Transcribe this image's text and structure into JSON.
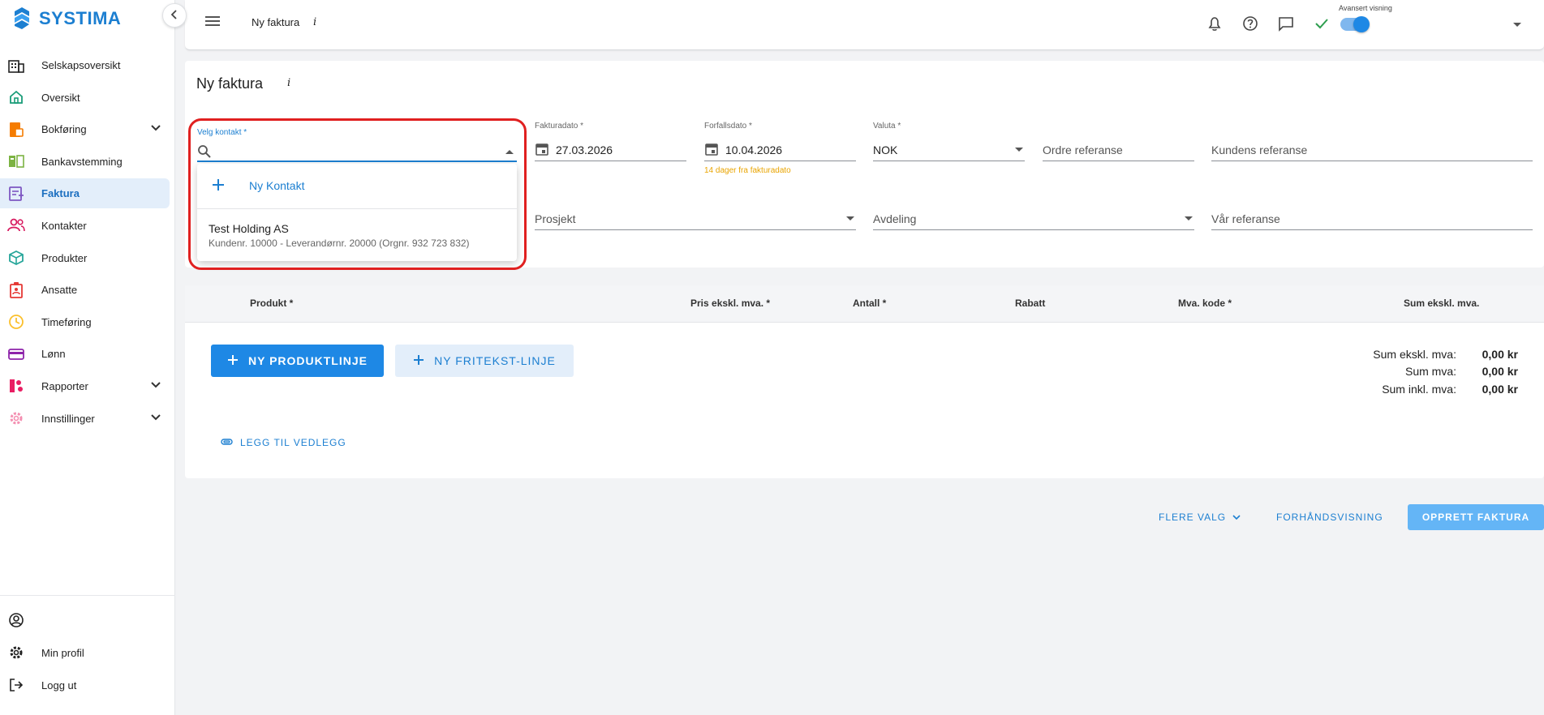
{
  "brand": {
    "name": "SYSTIMA"
  },
  "sidebar": {
    "items": [
      {
        "label": "Selskapsoversikt",
        "icon": "company-overview-icon"
      },
      {
        "label": "Oversikt",
        "icon": "home-icon"
      },
      {
        "label": "Bokføring",
        "icon": "bookkeeping-icon",
        "expandable": true
      },
      {
        "label": "Bankavstemming",
        "icon": "bank-reconciliation-icon"
      },
      {
        "label": "Faktura",
        "icon": "invoice-icon",
        "active": true
      },
      {
        "label": "Kontakter",
        "icon": "contacts-icon"
      },
      {
        "label": "Produkter",
        "icon": "products-icon"
      },
      {
        "label": "Ansatte",
        "icon": "employees-icon"
      },
      {
        "label": "Timeføring",
        "icon": "clock-icon"
      },
      {
        "label": "Lønn",
        "icon": "payroll-icon"
      },
      {
        "label": "Rapporter",
        "icon": "reports-icon",
        "expandable": true
      },
      {
        "label": "Innstillinger",
        "icon": "settings-icon",
        "expandable": true
      }
    ],
    "bottom": [
      {
        "label": "",
        "icon": "account-circle-icon"
      },
      {
        "label": "Min profil",
        "icon": "gear-icon"
      },
      {
        "label": "Logg ut",
        "icon": "logout-icon"
      }
    ]
  },
  "topbar": {
    "title": "Ny faktura",
    "info": "i",
    "advanced_view_label": "Avansert visning",
    "advanced_view_on": true
  },
  "form": {
    "title": "Ny faktura",
    "info": "i",
    "contact": {
      "label": "Velg kontakt *",
      "value": ""
    },
    "invoice_date": {
      "label": "Fakturadato *",
      "value": "27.03.2026"
    },
    "due_date": {
      "label": "Forfallsdato *",
      "value": "10.04.2026",
      "hint": "14 dager fra fakturadato"
    },
    "currency": {
      "label": "Valuta *",
      "value": "NOK"
    },
    "order_ref": {
      "placeholder": "Ordre referanse"
    },
    "customer_ref": {
      "placeholder": "Kundens referanse"
    },
    "project": {
      "placeholder": "Prosjekt"
    },
    "department": {
      "placeholder": "Avdeling"
    },
    "our_ref": {
      "placeholder": "Vår referanse"
    }
  },
  "contact_dropdown": {
    "new_contact": "Ny Kontakt",
    "options": [
      {
        "name": "Test Holding AS",
        "details": "Kundenr. 10000 - Leverandørnr. 20000 (Orgnr. 932 723 832)"
      }
    ]
  },
  "products": {
    "columns": [
      "Produkt *",
      "Pris ekskl. mva. *",
      "Antall *",
      "Rabatt",
      "Mva. kode *",
      "Sum ekskl. mva."
    ],
    "add_product_line": "NY PRODUKTLINJE",
    "add_freetext_line": "NY FRITEKST-LINJE",
    "attach": "LEGG TIL VEDLEGG",
    "totals": [
      {
        "label": "Sum ekskl. mva:",
        "value": "0,00 kr"
      },
      {
        "label": "Sum mva:",
        "value": "0,00 kr"
      },
      {
        "label": "Sum inkl. mva:",
        "value": "0,00 kr"
      }
    ]
  },
  "actions": {
    "more": "FLERE VALG",
    "preview": "FORHÅNDSVISNING",
    "create": "OPPRETT FAKTURA"
  },
  "colors": {
    "accent": "#1e88e5",
    "active_bg": "#e3eefa",
    "highlight": "#e02020",
    "hint": "#e9a400"
  }
}
